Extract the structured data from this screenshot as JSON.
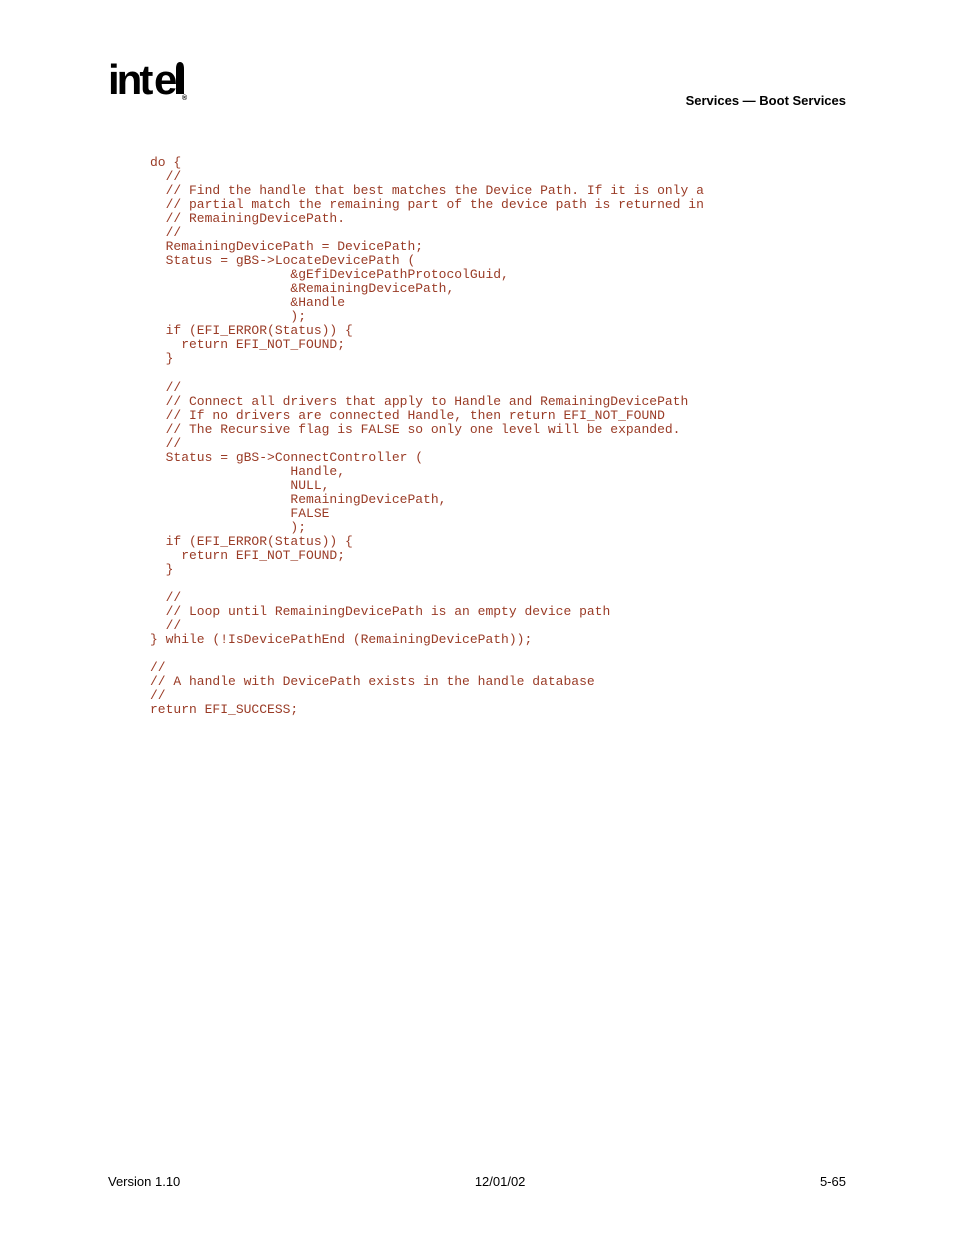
{
  "header": {
    "logo_text": "intel",
    "section_title": "Services — Boot Services"
  },
  "code": {
    "lines": [
      "do {",
      "  //",
      "  // Find the handle that best matches the Device Path. If it is only a",
      "  // partial match the remaining part of the device path is returned in",
      "  // RemainingDevicePath.",
      "  //",
      "  RemainingDevicePath = DevicePath;",
      "  Status = gBS->LocateDevicePath (",
      "                  &gEfiDevicePathProtocolGuid,",
      "                  &RemainingDevicePath,",
      "                  &Handle",
      "                  );",
      "  if (EFI_ERROR(Status)) {",
      "    return EFI_NOT_FOUND;",
      "  }",
      "",
      "  //",
      "  // Connect all drivers that apply to Handle and RemainingDevicePath",
      "  // If no drivers are connected Handle, then return EFI_NOT_FOUND",
      "  // The Recursive flag is FALSE so only one level will be expanded.",
      "  //",
      "  Status = gBS->ConnectController (",
      "                  Handle,",
      "                  NULL,",
      "                  RemainingDevicePath,",
      "                  FALSE",
      "                  );",
      "  if (EFI_ERROR(Status)) {",
      "    return EFI_NOT_FOUND;",
      "  }",
      "",
      "  //",
      "  // Loop until RemainingDevicePath is an empty device path",
      "  //",
      "} while (!IsDevicePathEnd (RemainingDevicePath));",
      "",
      "//",
      "// A handle with DevicePath exists in the handle database",
      "//",
      "return EFI_SUCCESS;"
    ]
  },
  "footer": {
    "version": "Version 1.10",
    "date": "12/01/02",
    "page": "5-65"
  }
}
